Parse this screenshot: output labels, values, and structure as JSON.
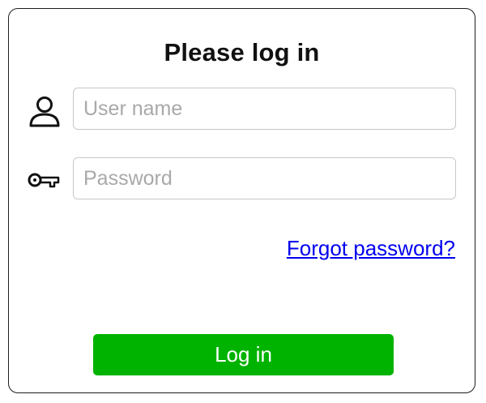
{
  "form": {
    "title": "Please log in",
    "username": {
      "icon": "user-icon",
      "placeholder": "User name",
      "value": ""
    },
    "password": {
      "icon": "key-icon",
      "placeholder": "Password",
      "value": ""
    },
    "forgot_link": "Forgot password?",
    "submit_label": "Log in"
  },
  "colors": {
    "button_bg": "#00b300",
    "button_text": "#ffffff",
    "link": "#0000ee",
    "input_border": "#c8c8c8",
    "card_border": "#1c1c1c"
  }
}
